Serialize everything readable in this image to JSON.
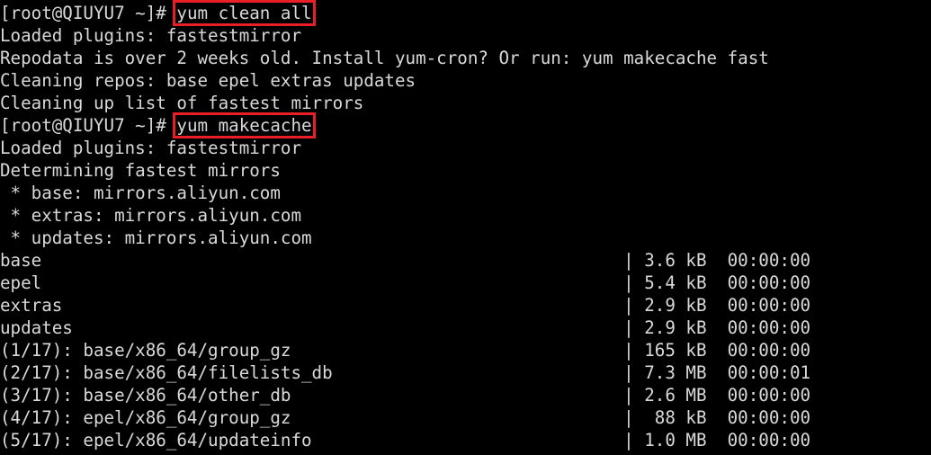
{
  "terminal": {
    "background_color": "#000000",
    "foreground_color": "#d9d9d9",
    "highlight_color": "#e81f26",
    "prompt": "[root@QIUYU7 ~]# ",
    "hostname": "QIUYU7",
    "user": "root",
    "cwd": "~",
    "lines": [
      {
        "id": "prompt-clean",
        "kind": "prompt",
        "prompt": "[root@QIUYU7 ~]# ",
        "command": "yum clean all",
        "highlighted": true
      },
      {
        "id": "out-loaded-plugins-1",
        "kind": "output",
        "text": "Loaded plugins: fastestmirror"
      },
      {
        "id": "out-repodata-warning",
        "kind": "output",
        "text": "Repodata is over 2 weeks old. Install yum-cron? Or run: yum makecache fast"
      },
      {
        "id": "out-cleaning-repos",
        "kind": "output",
        "text": "Cleaning repos: base epel extras updates"
      },
      {
        "id": "out-cleaning-mirrors",
        "kind": "output",
        "text": "Cleaning up list of fastest mirrors"
      },
      {
        "id": "prompt-makecache",
        "kind": "prompt",
        "prompt": "[root@QIUYU7 ~]# ",
        "command": "yum makecache",
        "highlighted": true
      },
      {
        "id": "out-loaded-plugins-2",
        "kind": "output",
        "text": "Loaded plugins: fastestmirror"
      },
      {
        "id": "out-determining",
        "kind": "output",
        "text": "Determining fastest mirrors"
      },
      {
        "id": "out-mirror-base",
        "kind": "output",
        "text": " * base: mirrors.aliyun.com"
      },
      {
        "id": "out-mirror-extras",
        "kind": "output",
        "text": " * extras: mirrors.aliyun.com"
      },
      {
        "id": "out-mirror-updates",
        "kind": "output",
        "text": " * updates: mirrors.aliyun.com"
      },
      {
        "id": "repo-base",
        "kind": "transfer",
        "text": "base                                                        | 3.6 kB  00:00:00     "
      },
      {
        "id": "repo-epel",
        "kind": "transfer",
        "text": "epel                                                        | 5.4 kB  00:00:00     "
      },
      {
        "id": "repo-extras",
        "kind": "transfer",
        "text": "extras                                                      | 2.9 kB  00:00:00     "
      },
      {
        "id": "repo-updates",
        "kind": "transfer",
        "text": "updates                                                     | 2.9 kB  00:00:00     "
      },
      {
        "id": "file-1-17",
        "kind": "transfer",
        "text": "(1/17): base/x86_64/group_gz                                | 165 kB  00:00:00     "
      },
      {
        "id": "file-2-17",
        "kind": "transfer",
        "text": "(2/17): base/x86_64/filelists_db                            | 7.3 MB  00:00:01     "
      },
      {
        "id": "file-3-17",
        "kind": "transfer",
        "text": "(3/17): base/x86_64/other_db                                | 2.6 MB  00:00:00     "
      },
      {
        "id": "file-4-17",
        "kind": "transfer",
        "text": "(4/17): epel/x86_64/group_gz                                |  88 kB  00:00:00     "
      },
      {
        "id": "file-5-17",
        "kind": "transfer",
        "text": "(5/17): epel/x86_64/updateinfo                              | 1.0 MB  00:00:00     "
      }
    ],
    "transfers": [
      {
        "name": "base",
        "size": "3.6 kB",
        "time": "00:00:00"
      },
      {
        "name": "epel",
        "size": "5.4 kB",
        "time": "00:00:00"
      },
      {
        "name": "extras",
        "size": "2.9 kB",
        "time": "00:00:00"
      },
      {
        "name": "updates",
        "size": "2.9 kB",
        "time": "00:00:00"
      },
      {
        "counter": "(1/17):",
        "name": "base/x86_64/group_gz",
        "size": "165 kB",
        "time": "00:00:00"
      },
      {
        "counter": "(2/17):",
        "name": "base/x86_64/filelists_db",
        "size": "7.3 MB",
        "time": "00:00:01"
      },
      {
        "counter": "(3/17):",
        "name": "base/x86_64/other_db",
        "size": "2.6 MB",
        "time": "00:00:00"
      },
      {
        "counter": "(4/17):",
        "name": "epel/x86_64/group_gz",
        "size": "88 kB",
        "time": "00:00:00"
      },
      {
        "counter": "(5/17):",
        "name": "epel/x86_64/updateinfo",
        "size": "1.0 MB",
        "time": "00:00:00"
      }
    ],
    "mirrors": [
      {
        "repo": "base",
        "host": "mirrors.aliyun.com"
      },
      {
        "repo": "extras",
        "host": "mirrors.aliyun.com"
      },
      {
        "repo": "updates",
        "host": "mirrors.aliyun.com"
      }
    ],
    "commands": [
      "yum clean all",
      "yum makecache"
    ]
  }
}
